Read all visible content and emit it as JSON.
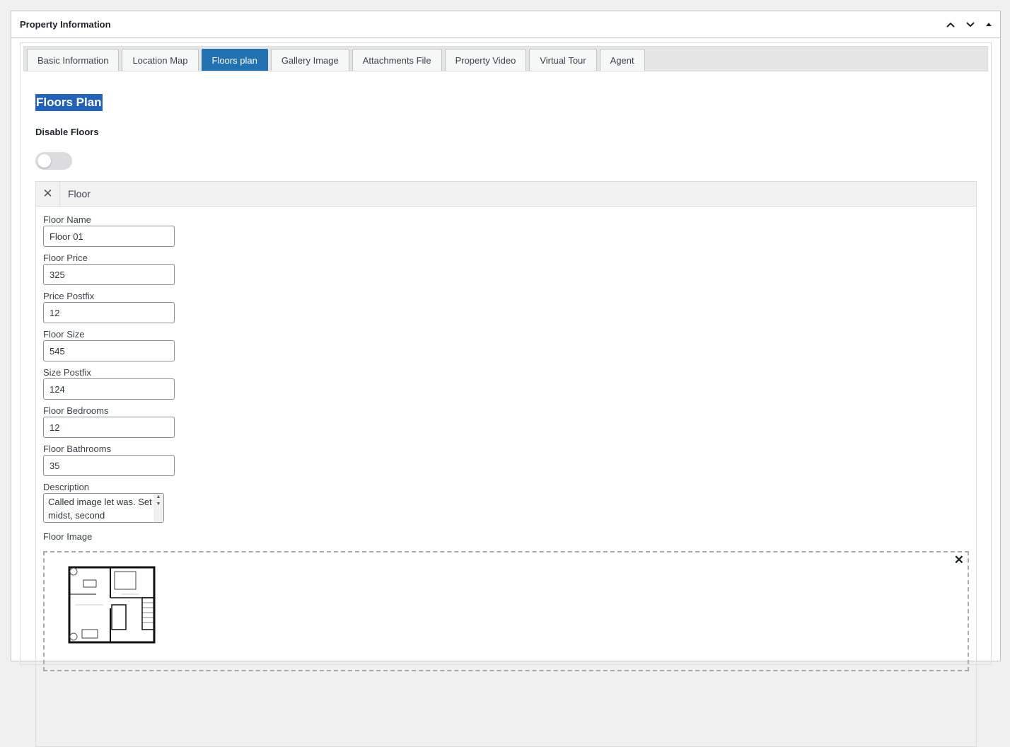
{
  "postbox": {
    "title": "Property Information"
  },
  "tabs": [
    {
      "label": "Basic Information"
    },
    {
      "label": "Location Map"
    },
    {
      "label": "Floors plan"
    },
    {
      "label": "Gallery Image"
    },
    {
      "label": "Attachments File"
    },
    {
      "label": "Property Video"
    },
    {
      "label": "Virtual Tour"
    },
    {
      "label": "Agent"
    }
  ],
  "active_tab": "Floors plan",
  "section": {
    "heading": "Floors Plan",
    "disable_label": "Disable Floors",
    "disable_enabled": false
  },
  "floor": {
    "title": "Floor",
    "remove_symbol": "✕",
    "fields": {
      "name": {
        "label": "Floor Name",
        "value": "Floor 01"
      },
      "price": {
        "label": "Floor Price",
        "value": "325"
      },
      "price_postfix": {
        "label": "Price Postfix",
        "value": "12"
      },
      "size": {
        "label": "Floor Size",
        "value": "545"
      },
      "size_postfix": {
        "label": "Size Postfix",
        "value": "124"
      },
      "bedrooms": {
        "label": "Floor Bedrooms",
        "value": "12"
      },
      "bathrooms": {
        "label": "Floor Bathrooms",
        "value": "35"
      },
      "description": {
        "label": "Description",
        "value": "Called image let was. Set midst, second"
      }
    },
    "image": {
      "label": "Floor Image",
      "close_symbol": "✕",
      "thumb_icon": "floor-plan-thumbnail"
    }
  },
  "colors": {
    "accent": "#2271b1",
    "heading_highlight": "#2262b8",
    "toggle_off": "#dcdcde"
  }
}
